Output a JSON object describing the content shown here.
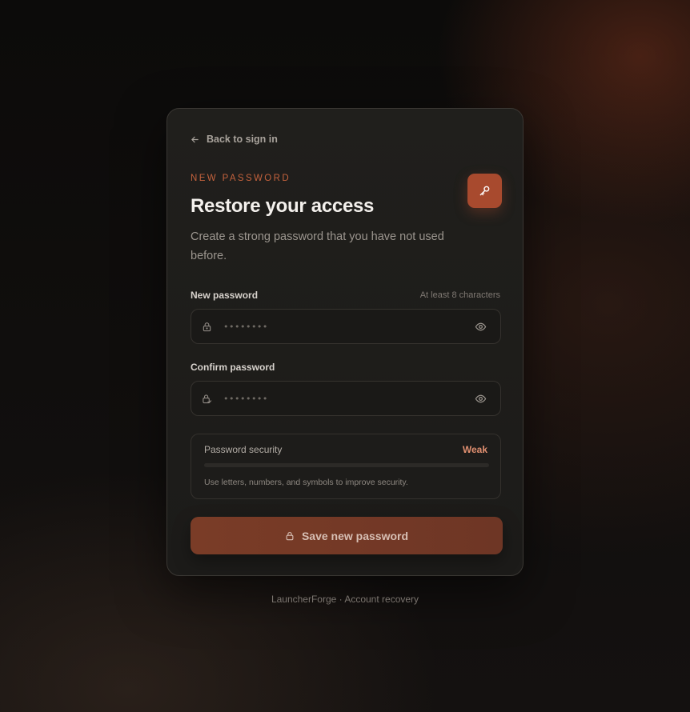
{
  "back_link": {
    "label": "Back to sign in",
    "icon": "arrow-left-icon"
  },
  "header": {
    "eyebrow": "NEW PASSWORD",
    "title": "Restore your access",
    "subtitle": "Create a strong password that you have not used before.",
    "badge_icon": "key-icon",
    "accent_color": "#a84a2e"
  },
  "new_password": {
    "label": "New password",
    "hint": "At least 8 characters",
    "value": "••••••••",
    "lead_icon": "lock-icon",
    "toggle_icon": "eye-icon"
  },
  "confirm_password": {
    "label": "Confirm password",
    "value": "••••••••",
    "lead_icon": "lock-check-icon",
    "toggle_icon": "eye-icon"
  },
  "security": {
    "title": "Password security",
    "level": "Weak",
    "level_color": "#e08f70",
    "strength_fraction": 0,
    "note": "Use letters, numbers, and symbols to improve security."
  },
  "save_button": {
    "label": "Save new password",
    "icon": "lock-icon"
  },
  "footer": {
    "text": "LauncherForge · Account recovery"
  }
}
